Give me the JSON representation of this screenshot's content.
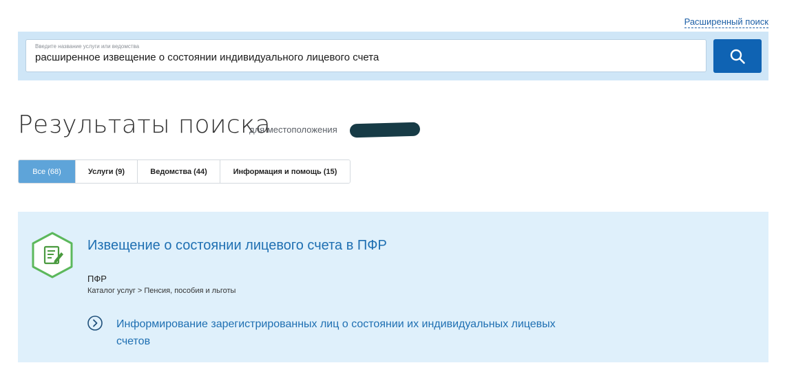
{
  "header": {
    "advanced_search": "Расширенный поиск"
  },
  "search": {
    "placeholder": "Введите название услуги или ведомства",
    "value": "расширенное извещение о состоянии индивидуального лицевого счета",
    "button_icon": "search-icon"
  },
  "results": {
    "title": "Результаты поиска",
    "location_label": "для местоположения"
  },
  "tabs": [
    {
      "label": "Все (68)",
      "active": true
    },
    {
      "label": "Услуги (9)",
      "active": false
    },
    {
      "label": "Ведомства (44)",
      "active": false
    },
    {
      "label": "Информация и помощь (15)",
      "active": false
    }
  ],
  "result_card": {
    "icon": "document-edit-icon",
    "title": "Извещение о состоянии лицевого счета в ПФР",
    "organization": "ПФР",
    "breadcrumb": "Каталог услуг > Пенсия, пособия и льготы",
    "sub_service": "Информирование зарегистрированных лиц о состоянии их индивидуальных лицевых счетов",
    "sub_icon": "chevron-right-circle-icon"
  },
  "colors": {
    "accent": "#0f63b3",
    "link": "#1e6fb2",
    "search_band": "#cfe6f7",
    "card_bg": "#dff0fb",
    "active_tab": "#5ea4d9",
    "icon_green": "#5cb85c"
  }
}
